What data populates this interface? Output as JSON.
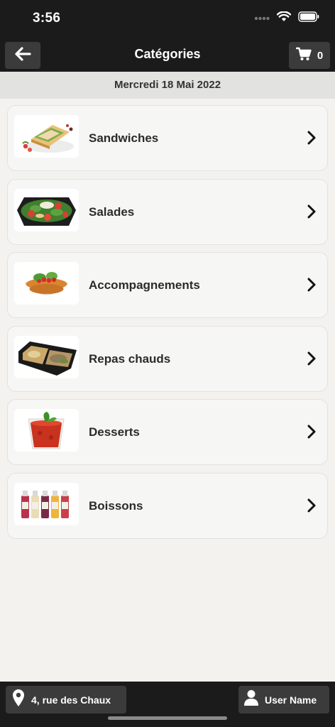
{
  "status": {
    "time": "3:56"
  },
  "header": {
    "title": "Catégories",
    "cart_count": "0"
  },
  "date": "Mercredi 18 Mai 2022",
  "categories": [
    {
      "label": "Sandwiches",
      "icon": "sandwich-image"
    },
    {
      "label": "Salades",
      "icon": "salad-image"
    },
    {
      "label": "Accompagnements",
      "icon": "side-dish-image"
    },
    {
      "label": "Repas chauds",
      "icon": "hot-meal-image"
    },
    {
      "label": "Desserts",
      "icon": "dessert-image"
    },
    {
      "label": "Boissons",
      "icon": "drinks-image"
    }
  ],
  "footer": {
    "location": "4, rue des Chaux",
    "user": "User Name"
  },
  "colors": {
    "dark": "#1b1b1b",
    "button": "#3b3b3b",
    "background": "#f3f2ee"
  }
}
